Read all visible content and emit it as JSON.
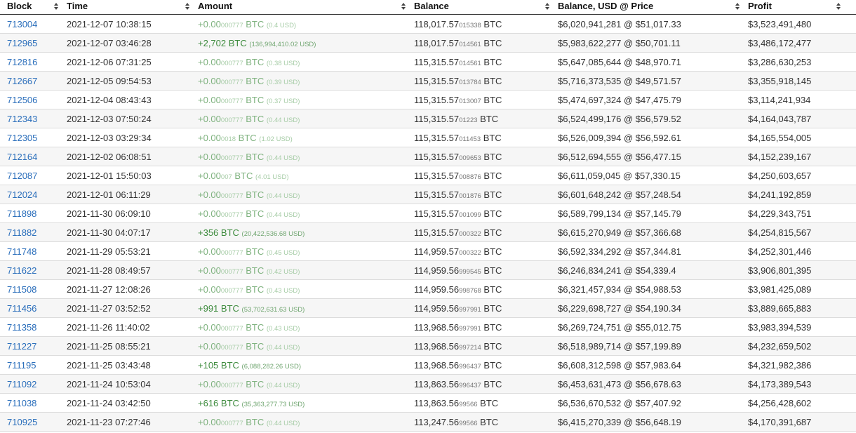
{
  "columns": {
    "block": "Block",
    "time": "Time",
    "amount": "Amount",
    "balance": "Balance",
    "balance_usd": "Balance, USD @ Price",
    "profit": "Profit"
  },
  "colors": {
    "link": "#2a6ebb",
    "positive": "#3d8b3d",
    "positive_faded": "#7fb27f"
  },
  "rows": [
    {
      "block": "713004",
      "time": "2021-12-07 10:38:15",
      "amount_main": "+0.00",
      "amount_small": "000777",
      "amount_unit": " BTC",
      "amount_usd": "(0.4 USD)",
      "faded": true,
      "bal_main": "118,017.57",
      "bal_small": "015338",
      "bal_unit": " BTC",
      "bal_usd": "$6,020,941,281 @ $51,017.33",
      "profit": "$3,523,491,480"
    },
    {
      "block": "712965",
      "time": "2021-12-07 03:46:28",
      "amount_main": "+2,702",
      "amount_small": "",
      "amount_unit": " BTC",
      "amount_usd": "(136,994,410.02 USD)",
      "faded": false,
      "bal_main": "118,017.57",
      "bal_small": "014561",
      "bal_unit": " BTC",
      "bal_usd": "$5,983,622,277 @ $50,701.11",
      "profit": "$3,486,172,477"
    },
    {
      "block": "712816",
      "time": "2021-12-06 07:31:25",
      "amount_main": "+0.00",
      "amount_small": "000777",
      "amount_unit": " BTC",
      "amount_usd": "(0.38 USD)",
      "faded": true,
      "bal_main": "115,315.57",
      "bal_small": "014561",
      "bal_unit": " BTC",
      "bal_usd": "$5,647,085,644 @ $48,970.71",
      "profit": "$3,286,630,253"
    },
    {
      "block": "712667",
      "time": "2021-12-05 09:54:53",
      "amount_main": "+0.00",
      "amount_small": "000777",
      "amount_unit": " BTC",
      "amount_usd": "(0.39 USD)",
      "faded": true,
      "bal_main": "115,315.57",
      "bal_small": "013784",
      "bal_unit": " BTC",
      "bal_usd": "$5,716,373,535 @ $49,571.57",
      "profit": "$3,355,918,145"
    },
    {
      "block": "712506",
      "time": "2021-12-04 08:43:43",
      "amount_main": "+0.00",
      "amount_small": "000777",
      "amount_unit": " BTC",
      "amount_usd": "(0.37 USD)",
      "faded": true,
      "bal_main": "115,315.57",
      "bal_small": "013007",
      "bal_unit": " BTC",
      "bal_usd": "$5,474,697,324 @ $47,475.79",
      "profit": "$3,114,241,934"
    },
    {
      "block": "712343",
      "time": "2021-12-03 07:50:24",
      "amount_main": "+0.00",
      "amount_small": "000777",
      "amount_unit": " BTC",
      "amount_usd": "(0.44 USD)",
      "faded": true,
      "bal_main": "115,315.57",
      "bal_small": "01223",
      "bal_unit": " BTC",
      "bal_usd": "$6,524,499,176 @ $56,579.52",
      "profit": "$4,164,043,787"
    },
    {
      "block": "712305",
      "time": "2021-12-03 03:29:34",
      "amount_main": "+0.00",
      "amount_small": "0018",
      "amount_unit": " BTC",
      "amount_usd": "(1.02 USD)",
      "faded": true,
      "bal_main": "115,315.57",
      "bal_small": "011453",
      "bal_unit": " BTC",
      "bal_usd": "$6,526,009,394 @ $56,592.61",
      "profit": "$4,165,554,005"
    },
    {
      "block": "712164",
      "time": "2021-12-02 06:08:51",
      "amount_main": "+0.00",
      "amount_small": "000777",
      "amount_unit": " BTC",
      "amount_usd": "(0.44 USD)",
      "faded": true,
      "bal_main": "115,315.57",
      "bal_small": "009653",
      "bal_unit": " BTC",
      "bal_usd": "$6,512,694,555 @ $56,477.15",
      "profit": "$4,152,239,167"
    },
    {
      "block": "712087",
      "time": "2021-12-01 15:50:03",
      "amount_main": "+0.00",
      "amount_small": "007",
      "amount_unit": " BTC",
      "amount_usd": "(4.01 USD)",
      "faded": true,
      "bal_main": "115,315.57",
      "bal_small": "008876",
      "bal_unit": " BTC",
      "bal_usd": "$6,611,059,045 @ $57,330.15",
      "profit": "$4,250,603,657"
    },
    {
      "block": "712024",
      "time": "2021-12-01 06:11:29",
      "amount_main": "+0.00",
      "amount_small": "000777",
      "amount_unit": " BTC",
      "amount_usd": "(0.44 USD)",
      "faded": true,
      "bal_main": "115,315.57",
      "bal_small": "001876",
      "bal_unit": " BTC",
      "bal_usd": "$6,601,648,242 @ $57,248.54",
      "profit": "$4,241,192,859"
    },
    {
      "block": "711898",
      "time": "2021-11-30 06:09:10",
      "amount_main": "+0.00",
      "amount_small": "000777",
      "amount_unit": " BTC",
      "amount_usd": "(0.44 USD)",
      "faded": true,
      "bal_main": "115,315.57",
      "bal_small": "001099",
      "bal_unit": " BTC",
      "bal_usd": "$6,589,799,134 @ $57,145.79",
      "profit": "$4,229,343,751"
    },
    {
      "block": "711882",
      "time": "2021-11-30 04:07:17",
      "amount_main": "+356",
      "amount_small": "",
      "amount_unit": " BTC",
      "amount_usd": "(20,422,536.68 USD)",
      "faded": false,
      "bal_main": "115,315.57",
      "bal_small": "000322",
      "bal_unit": " BTC",
      "bal_usd": "$6,615,270,949 @ $57,366.68",
      "profit": "$4,254,815,567"
    },
    {
      "block": "711748",
      "time": "2021-11-29 05:53:21",
      "amount_main": "+0.00",
      "amount_small": "000777",
      "amount_unit": " BTC",
      "amount_usd": "(0.45 USD)",
      "faded": true,
      "bal_main": "114,959.57",
      "bal_small": "000322",
      "bal_unit": " BTC",
      "bal_usd": "$6,592,334,292 @ $57,344.81",
      "profit": "$4,252,301,446"
    },
    {
      "block": "711622",
      "time": "2021-11-28 08:49:57",
      "amount_main": "+0.00",
      "amount_small": "000777",
      "amount_unit": " BTC",
      "amount_usd": "(0.42 USD)",
      "faded": true,
      "bal_main": "114,959.56",
      "bal_small": "999545",
      "bal_unit": " BTC",
      "bal_usd": "$6,246,834,241 @ $54,339.4",
      "profit": "$3,906,801,395"
    },
    {
      "block": "711508",
      "time": "2021-11-27 12:08:26",
      "amount_main": "+0.00",
      "amount_small": "000777",
      "amount_unit": " BTC",
      "amount_usd": "(0.43 USD)",
      "faded": true,
      "bal_main": "114,959.56",
      "bal_small": "998768",
      "bal_unit": " BTC",
      "bal_usd": "$6,321,457,934 @ $54,988.53",
      "profit": "$3,981,425,089"
    },
    {
      "block": "711456",
      "time": "2021-11-27 03:52:52",
      "amount_main": "+991",
      "amount_small": "",
      "amount_unit": " BTC",
      "amount_usd": "(53,702,631.63 USD)",
      "faded": false,
      "bal_main": "114,959.56",
      "bal_small": "997991",
      "bal_unit": " BTC",
      "bal_usd": "$6,229,698,727 @ $54,190.34",
      "profit": "$3,889,665,883"
    },
    {
      "block": "711358",
      "time": "2021-11-26 11:40:02",
      "amount_main": "+0.00",
      "amount_small": "000777",
      "amount_unit": " BTC",
      "amount_usd": "(0.43 USD)",
      "faded": true,
      "bal_main": "113,968.56",
      "bal_small": "997991",
      "bal_unit": " BTC",
      "bal_usd": "$6,269,724,751 @ $55,012.75",
      "profit": "$3,983,394,539"
    },
    {
      "block": "711227",
      "time": "2021-11-25 08:55:21",
      "amount_main": "+0.00",
      "amount_small": "000777",
      "amount_unit": " BTC",
      "amount_usd": "(0.44 USD)",
      "faded": true,
      "bal_main": "113,968.56",
      "bal_small": "997214",
      "bal_unit": " BTC",
      "bal_usd": "$6,518,989,714 @ $57,199.89",
      "profit": "$4,232,659,502"
    },
    {
      "block": "711195",
      "time": "2021-11-25 03:43:48",
      "amount_main": "+105",
      "amount_small": "",
      "amount_unit": " BTC",
      "amount_usd": "(6,088,282.26 USD)",
      "faded": false,
      "bal_main": "113,968.56",
      "bal_small": "996437",
      "bal_unit": " BTC",
      "bal_usd": "$6,608,312,598 @ $57,983.64",
      "profit": "$4,321,982,386"
    },
    {
      "block": "711092",
      "time": "2021-11-24 10:53:04",
      "amount_main": "+0.00",
      "amount_small": "000777",
      "amount_unit": " BTC",
      "amount_usd": "(0.44 USD)",
      "faded": true,
      "bal_main": "113,863.56",
      "bal_small": "996437",
      "bal_unit": " BTC",
      "bal_usd": "$6,453,631,473 @ $56,678.63",
      "profit": "$4,173,389,543"
    },
    {
      "block": "711038",
      "time": "2021-11-24 03:42:50",
      "amount_main": "+616",
      "amount_small": "",
      "amount_unit": " BTC",
      "amount_usd": "(35,363,277.73 USD)",
      "faded": false,
      "bal_main": "113,863.56",
      "bal_small": "99566",
      "bal_unit": " BTC",
      "bal_usd": "$6,536,670,532 @ $57,407.92",
      "profit": "$4,256,428,602"
    },
    {
      "block": "710925",
      "time": "2021-11-23 07:27:46",
      "amount_main": "+0.00",
      "amount_small": "000777",
      "amount_unit": " BTC",
      "amount_usd": "(0.44 USD)",
      "faded": true,
      "bal_main": "113,247.56",
      "bal_small": "99566",
      "bal_unit": " BTC",
      "bal_usd": "$6,415,270,339 @ $56,648.19",
      "profit": "$4,170,391,687"
    }
  ]
}
